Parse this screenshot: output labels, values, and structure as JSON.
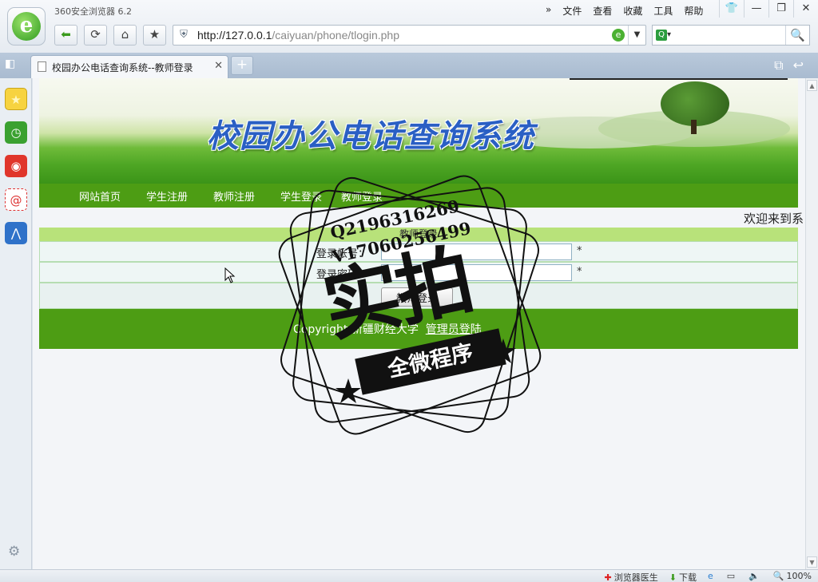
{
  "browser": {
    "app_title": "360安全浏览器 6.2",
    "menu": [
      "文件",
      "查看",
      "收藏",
      "工具",
      "帮助"
    ],
    "url_host": "http://127.0.0.1",
    "url_path": "/caiyuan/phone/tlogin.php",
    "tab_title": "校园办公电话查询系统--教师登录",
    "status": {
      "doctor": "浏览器医生",
      "download": "下载",
      "zoom": "100%"
    }
  },
  "page": {
    "banner_title": "校园办公电话查询系统",
    "nav": [
      "网站首页",
      "学生注册",
      "教师注册",
      "学生登录",
      "教师登录"
    ],
    "welcome": "欢迎来到系",
    "form": {
      "header": "教师登录",
      "account_label": "登录帐号：",
      "account_value": "",
      "password_label": "登录密码：",
      "password_value": "",
      "required_mark": "*",
      "submit_label": "教师登录"
    },
    "footer": {
      "text": "Copyright  新疆财经大学",
      "admin_link": "管理员登陆"
    }
  },
  "watermark": {
    "line1": "Q2196316269",
    "line2": "V17060256499",
    "big": "实拍",
    "ribbon": "全微程序"
  },
  "colors": {
    "nav_green": "#4d9d14",
    "form_header": "#b8e27a",
    "title_blue": "#2a5fc4"
  }
}
